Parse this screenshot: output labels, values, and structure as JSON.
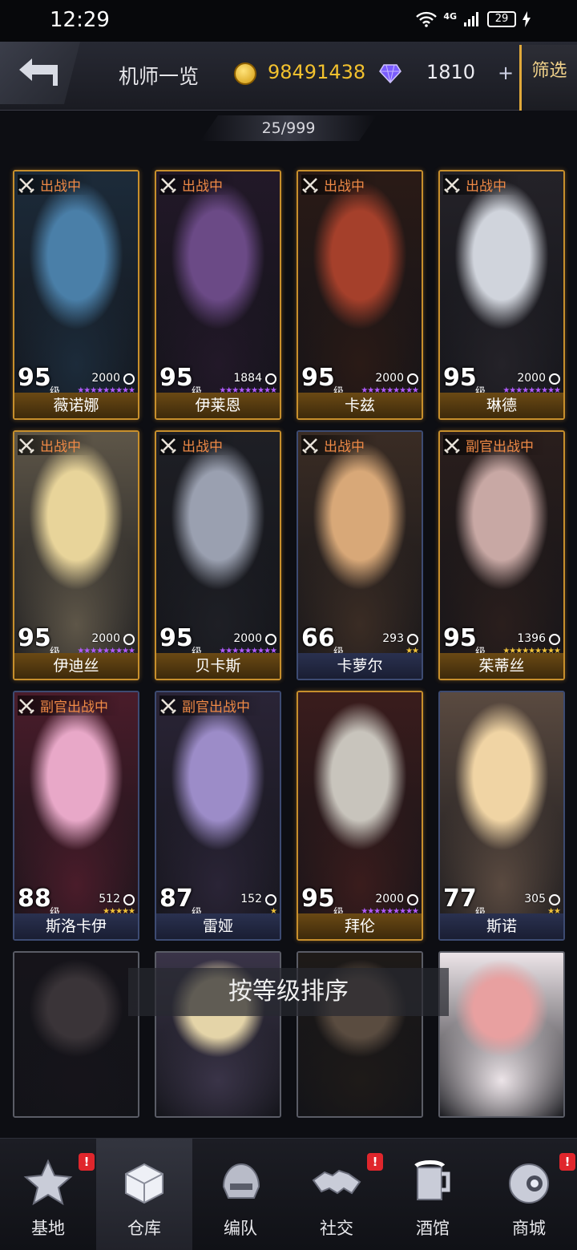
{
  "status_bar": {
    "time": "12:29",
    "network": "4G",
    "battery": "29"
  },
  "header": {
    "title": "机师一览",
    "gold": "98491438",
    "gems": "1810",
    "gem_plus": "+",
    "filter_label": "筛选",
    "pilot_count": "25/999"
  },
  "colors": {
    "gold_frame": "#c78f2c",
    "deploy_tag": "#f08a46",
    "gold_text": "#f2c12e",
    "badge": "#e0262c"
  },
  "cards": [
    {
      "name": "薇诺娜",
      "level": "95",
      "unit": "级",
      "power": "2000",
      "stars": "★★★★★★★★★",
      "star_color": "#b25cff",
      "tag": "出战中",
      "frame": "gold"
    },
    {
      "name": "伊莱恩",
      "level": "95",
      "unit": "级",
      "power": "1884",
      "stars": "★★★★★★★★★",
      "star_color": "#b25cff",
      "tag": "出战中",
      "frame": "gold"
    },
    {
      "name": "卡兹",
      "level": "95",
      "unit": "级",
      "power": "2000",
      "stars": "★★★★★★★★★",
      "star_color": "#b25cff",
      "tag": "出战中",
      "frame": "gold"
    },
    {
      "name": "琳德",
      "level": "95",
      "unit": "级",
      "power": "2000",
      "stars": "★★★★★★★★★",
      "star_color": "#b25cff",
      "tag": "出战中",
      "frame": "gold"
    },
    {
      "name": "伊迪丝",
      "level": "95",
      "unit": "级",
      "power": "2000",
      "stars": "★★★★★★★★★",
      "star_color": "#b25cff",
      "tag": "出战中",
      "frame": "gold"
    },
    {
      "name": "贝卡斯",
      "level": "95",
      "unit": "级",
      "power": "2000",
      "stars": "★★★★★★★★★",
      "star_color": "#b25cff",
      "tag": "出战中",
      "frame": "gold"
    },
    {
      "name": "卡萝尔",
      "level": "66",
      "unit": "级",
      "power": "293",
      "stars": "★★",
      "star_color": "#f0c23a",
      "tag": "出战中",
      "frame": "blue"
    },
    {
      "name": "茱蒂丝",
      "level": "95",
      "unit": "级",
      "power": "1396",
      "stars": "★★★★★★★★★",
      "star_color": "#f0c23a",
      "tag": "副官出战中",
      "frame": "gold"
    },
    {
      "name": "斯洛卡伊",
      "level": "88",
      "unit": "级",
      "power": "512",
      "stars": "★★★★★",
      "star_color": "#f0c23a",
      "tag": "副官出战中",
      "frame": "blue"
    },
    {
      "name": "雷娅",
      "level": "87",
      "unit": "级",
      "power": "152",
      "stars": "★",
      "star_color": "#f0c23a",
      "tag": "副官出战中",
      "frame": "blue"
    },
    {
      "name": "拜伦",
      "level": "95",
      "unit": "级",
      "power": "2000",
      "stars": "★★★★★★★★★",
      "star_color": "#b25cff",
      "tag": "",
      "frame": "gold"
    },
    {
      "name": "斯诺",
      "level": "77",
      "unit": "级",
      "power": "305",
      "stars": "★★",
      "star_color": "#f0c23a",
      "tag": "",
      "frame": "blue"
    },
    {
      "name": "",
      "level": "",
      "unit": "",
      "power": "",
      "stars": "",
      "star_color": "#ffffff",
      "tag": "",
      "frame": "gray"
    },
    {
      "name": "",
      "level": "",
      "unit": "",
      "power": "",
      "stars": "",
      "star_color": "#ffffff",
      "tag": "",
      "frame": "gray"
    },
    {
      "name": "",
      "level": "",
      "unit": "",
      "power": "",
      "stars": "",
      "star_color": "#ffffff",
      "tag": "",
      "frame": "gray"
    },
    {
      "name": "",
      "level": "",
      "unit": "",
      "power": "",
      "stars": "",
      "star_color": "#ffffff",
      "tag": "",
      "frame": "gray"
    }
  ],
  "toast": "按等级排序",
  "nav": [
    {
      "label": "基地",
      "icon": "base-star-icon",
      "badge": "!"
    },
    {
      "label": "仓库",
      "icon": "warehouse-box-icon",
      "badge": ""
    },
    {
      "label": "编队",
      "icon": "formation-helmet-icon",
      "badge": ""
    },
    {
      "label": "社交",
      "icon": "handshake-icon",
      "badge": "!"
    },
    {
      "label": "酒馆",
      "icon": "tavern-mug-icon",
      "badge": ""
    },
    {
      "label": "商城",
      "icon": "shop-orb-icon",
      "badge": "!"
    }
  ]
}
